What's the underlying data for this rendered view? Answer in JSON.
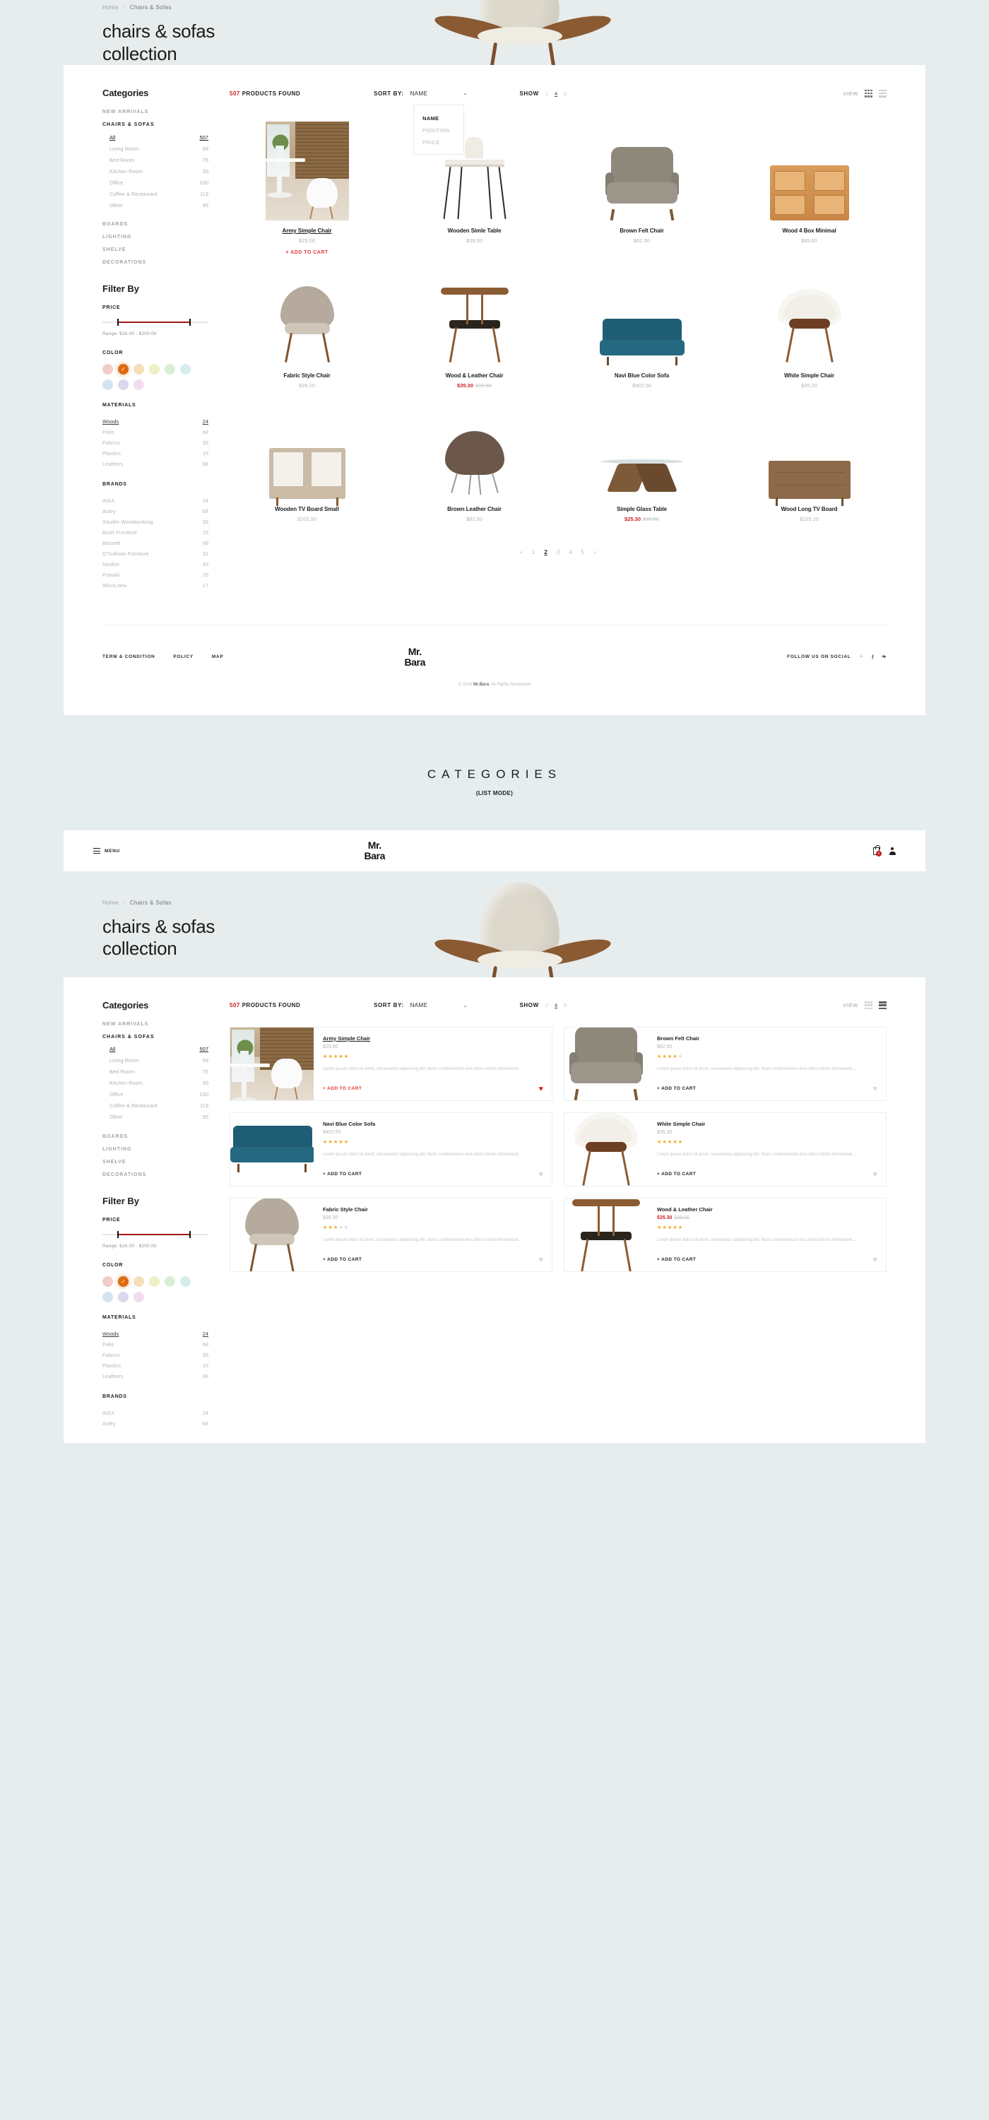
{
  "hero": {
    "breadcrumb_home": "Home",
    "breadcrumb_sep": "/",
    "breadcrumb_current": "Chairs & Sofas",
    "title_line1": "chairs & sofas",
    "title_line2": "collection"
  },
  "brand": {
    "line1": "Mr.",
    "line2": "Bara"
  },
  "header2": {
    "menu_label": "MENU",
    "cart_count": "2"
  },
  "sidebar": {
    "categories_title": "Categories",
    "groups": [
      {
        "label": "NEW ARRIVALS",
        "active": false
      },
      {
        "label": "CHAIRS & SOFAS",
        "active": true
      },
      {
        "label": "BOARDS",
        "active": false
      },
      {
        "label": "LIGHTING",
        "active": false
      },
      {
        "label": "SHELVE",
        "active": false
      },
      {
        "label": "DECORATIONS",
        "active": false
      }
    ],
    "chairs_items": [
      {
        "name": "All",
        "count": "507",
        "selected": true
      },
      {
        "name": "Living Room",
        "count": "68",
        "selected": false
      },
      {
        "name": "Bed Room",
        "count": "75",
        "selected": false
      },
      {
        "name": "Kitchen Room",
        "count": "30",
        "selected": false
      },
      {
        "name": "Office",
        "count": "150",
        "selected": false
      },
      {
        "name": "Coffee & Restaurant",
        "count": "113",
        "selected": false
      },
      {
        "name": "Other",
        "count": "95",
        "selected": false
      }
    ],
    "filter_title": "Filter By",
    "price_label": "PRICE",
    "price_range_text": "Range: $16.00 - $200.00",
    "color_label": "COLOR",
    "colors": [
      {
        "hex": "#f0cdc9",
        "selected": false
      },
      {
        "hex": "#dd6b10",
        "selected": true
      },
      {
        "hex": "#f5dfb8",
        "selected": false
      },
      {
        "hex": "#eff0c3",
        "selected": false
      },
      {
        "hex": "#d9efd3",
        "selected": false
      },
      {
        "hex": "#d6edee",
        "selected": false
      },
      {
        "hex": "#d3e4ef",
        "selected": false
      },
      {
        "hex": "#ddd6ef",
        "selected": false
      },
      {
        "hex": "#f2ddee",
        "selected": false
      }
    ],
    "materials_label": "MATERIALS",
    "materials": [
      {
        "name": "Woods",
        "count": "24",
        "selected": true
      },
      {
        "name": "Felts",
        "count": "68",
        "selected": false
      },
      {
        "name": "Fabrics",
        "count": "35",
        "selected": false
      },
      {
        "name": "Plastics",
        "count": "15",
        "selected": false
      },
      {
        "name": "Leathers",
        "count": "68",
        "selected": false
      }
    ],
    "brands_label": "BRANDS",
    "brands": [
      {
        "name": "IKEA",
        "count": "24"
      },
      {
        "name": "Asley",
        "count": "68"
      },
      {
        "name": "Sauder Woodworking",
        "count": "35"
      },
      {
        "name": "Bush Furniture",
        "count": "15"
      },
      {
        "name": "Bassett",
        "count": "68"
      },
      {
        "name": "O'Sullivan Furniture",
        "count": "32"
      },
      {
        "name": "Hooker",
        "count": "43"
      },
      {
        "name": "Pulaski",
        "count": "26"
      },
      {
        "name": "WinsLoew",
        "count": "17"
      }
    ]
  },
  "toolbar": {
    "count": "507",
    "found_label": "PRODUCTS FOUND",
    "sort_label": "SORT BY:",
    "sort_value": "NAME",
    "sort_options": [
      "NAME",
      "POSITION",
      "PRICE"
    ],
    "show_label": "SHOW",
    "show_options": [
      "2",
      "4",
      "6"
    ],
    "show_selected": "4",
    "view_label": "VIEW"
  },
  "grid_products": [
    {
      "name": "Army Simple Chair",
      "price": "$25.00",
      "old": "",
      "sale": false,
      "add_to_cart": "+ ADD TO CART",
      "art": "room"
    },
    {
      "name": "Wooden Simle Table",
      "price": "$39.00",
      "old": "",
      "sale": false,
      "add_to_cart": "",
      "art": "table"
    },
    {
      "name": "Brown Felt Chair",
      "price": "$62.50",
      "old": "",
      "sale": false,
      "add_to_cart": "",
      "art": "felt"
    },
    {
      "name": "Wood 4 Box Minimal",
      "price": "$85.60",
      "old": "",
      "sale": false,
      "add_to_cart": "",
      "art": "box"
    },
    {
      "name": "Fabric Style Chair",
      "price": "$39.20",
      "old": "",
      "sale": false,
      "add_to_cart": "",
      "art": "fab"
    },
    {
      "name": "Wood & Leather Chair",
      "price": "$35.30",
      "old": "$39.00",
      "sale": true,
      "add_to_cart": "",
      "art": "wl"
    },
    {
      "name": "Navi Blue Color Sofa",
      "price": "$402.50",
      "old": "",
      "sale": false,
      "add_to_cart": "",
      "art": "sofa"
    },
    {
      "name": "White Simple Chair",
      "price": "$35.20",
      "old": "",
      "sale": false,
      "add_to_cart": "",
      "art": "white"
    },
    {
      "name": "Wooden TV Board Small",
      "price": "$102.50",
      "old": "",
      "sale": false,
      "add_to_cart": "",
      "art": "tvs"
    },
    {
      "name": "Brown Leather Chair",
      "price": "$82.50",
      "old": "",
      "sale": false,
      "add_to_cart": "",
      "art": "brown"
    },
    {
      "name": "Simple Glass Table",
      "price": "$25.30",
      "old": "$36.50",
      "sale": true,
      "add_to_cart": "",
      "art": "glass"
    },
    {
      "name": "Wood Long TV Board",
      "price": "$235.20",
      "old": "",
      "sale": false,
      "add_to_cart": "",
      "art": "long"
    }
  ],
  "pagination": {
    "prev": "«",
    "pages": [
      "1",
      "2",
      "3",
      "4",
      "5"
    ],
    "current": "2",
    "next": "»"
  },
  "footer": {
    "links": [
      "TERM & CONDITION",
      "POLICY",
      "MAP"
    ],
    "social_label": "FOLLOW US ON SOCIAL",
    "icons": [
      "twitter-icon",
      "facebook-icon",
      "rss-icon"
    ],
    "copyright_pre": "© 2016 ",
    "copyright_brand": "Mr.Bara",
    "copyright_post": ". All Rights Resevered"
  },
  "divider": {
    "title": "CATEGORIES",
    "subtitle": "(LIST MODE)"
  },
  "list_description": "Lorem ipsum dolor sit amet, consectetur adipiscing elit. Nunc condimentum eros idoni rutrum fermentum...",
  "list_add_to_cart": "+ ADD TO CART",
  "list_products": [
    {
      "name": "Army Simple Chair",
      "price": "$25.00",
      "old": "",
      "sale": false,
      "stars": 5,
      "fav": true,
      "art": "room"
    },
    {
      "name": "Brown Felt Chair",
      "price": "$62.50",
      "old": "",
      "sale": false,
      "stars": 4,
      "fav": false,
      "art": "felt"
    },
    {
      "name": "Navi Blue Color Sofa",
      "price": "$402.50",
      "old": "",
      "sale": false,
      "stars": 5,
      "fav": false,
      "art": "sofa"
    },
    {
      "name": "White Simple Chair",
      "price": "$35.20",
      "old": "",
      "sale": false,
      "stars": 5,
      "fav": false,
      "art": "white"
    },
    {
      "name": "Fabric Style Chair",
      "price": "$39.20",
      "old": "",
      "sale": false,
      "stars": 3,
      "fav": false,
      "art": "fab"
    },
    {
      "name": "Wood & Leather Chair",
      "price": "$35.30",
      "old": "$39.00",
      "sale": true,
      "stars": 5,
      "fav": false,
      "art": "wl"
    }
  ]
}
